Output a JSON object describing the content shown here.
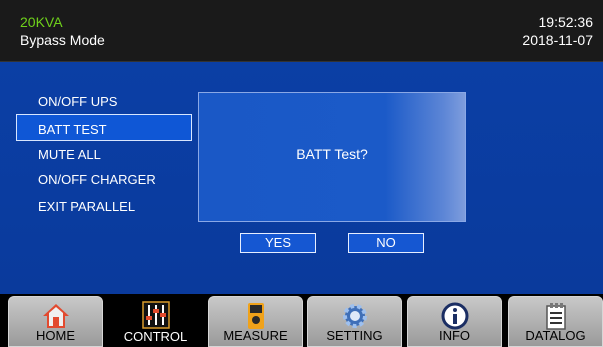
{
  "header": {
    "model": "20KVA",
    "mode": "Bypass Mode",
    "time": "19:52:36",
    "date": "2018-11-07"
  },
  "menu": {
    "items": [
      "ON/OFF UPS",
      "BATT TEST",
      "MUTE ALL",
      "ON/OFF CHARGER",
      "EXIT PARALLEL"
    ],
    "selected_index": 1
  },
  "dialog": {
    "message": "BATT Test?",
    "yes_label": "YES",
    "no_label": "NO"
  },
  "nav": {
    "tabs": [
      {
        "label": "HOME",
        "icon": "home-icon"
      },
      {
        "label": "CONTROL",
        "icon": "sliders-icon"
      },
      {
        "label": "MEASURE",
        "icon": "meter-icon"
      },
      {
        "label": "SETTING",
        "icon": "gear-icon"
      },
      {
        "label": "INFO",
        "icon": "info-icon"
      },
      {
        "label": "DATALOG",
        "icon": "log-icon"
      }
    ],
    "active_index": 1
  },
  "colors": {
    "model_green": "#6fd11b",
    "panel_blue": "#0b3fa5"
  }
}
